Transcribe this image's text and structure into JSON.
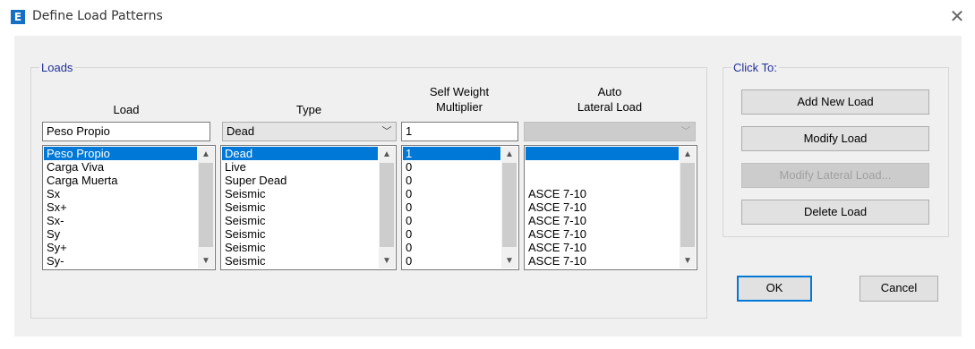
{
  "window": {
    "title": "Define Load Patterns",
    "app_icon_letter": "E",
    "close_glyph": "✕"
  },
  "loads_group": {
    "label": "Loads",
    "headers": {
      "load": "Load",
      "type": "Type",
      "self_weight_line1": "Self Weight",
      "self_weight_line2": "Multiplier",
      "auto_line1": "Auto",
      "auto_line2": "Lateral Load"
    },
    "load_input_value": "Peso Propio",
    "type_selected": "Dead",
    "multiplier_input_value": "1",
    "auto_lateral_selected": "",
    "rows": [
      {
        "load": "Peso Propio",
        "type": "Dead",
        "multiplier": "1",
        "auto": ""
      },
      {
        "load": "Carga Viva",
        "type": "Live",
        "multiplier": "0",
        "auto": ""
      },
      {
        "load": "Carga Muerta",
        "type": "Super Dead",
        "multiplier": "0",
        "auto": ""
      },
      {
        "load": "Sx",
        "type": "Seismic",
        "multiplier": "0",
        "auto": "ASCE 7-10"
      },
      {
        "load": "Sx+",
        "type": "Seismic",
        "multiplier": "0",
        "auto": "ASCE 7-10"
      },
      {
        "load": "Sx-",
        "type": "Seismic",
        "multiplier": "0",
        "auto": "ASCE 7-10"
      },
      {
        "load": "Sy",
        "type": "Seismic",
        "multiplier": "0",
        "auto": "ASCE 7-10"
      },
      {
        "load": "Sy+",
        "type": "Seismic",
        "multiplier": "0",
        "auto": "ASCE 7-10"
      },
      {
        "load": "Sy-",
        "type": "Seismic",
        "multiplier": "0",
        "auto": "ASCE 7-10"
      }
    ]
  },
  "click_to_group": {
    "label": "Click To:",
    "add_new_load": "Add New Load",
    "modify_load": "Modify Load",
    "modify_lateral_load": "Modify Lateral Load...",
    "delete_load": "Delete Load"
  },
  "dialog_buttons": {
    "ok": "OK",
    "cancel": "Cancel"
  },
  "icons": {
    "scroll_up": "▲",
    "scroll_down": "▼",
    "combo_arrow": "﹀"
  },
  "colors": {
    "selection": "#0078d7",
    "group_label": "#1f2f99",
    "app_icon": "#1570c4"
  }
}
